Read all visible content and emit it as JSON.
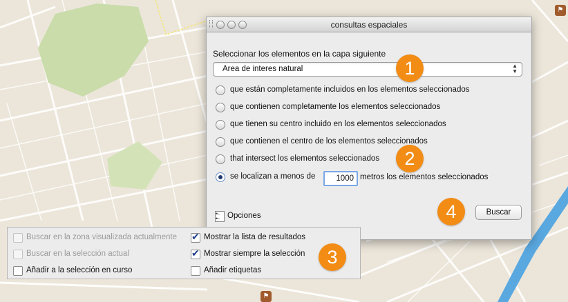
{
  "dialog": {
    "title": "consultas espaciales",
    "layer_caption": "Seleccionar los elementos en la capa siguiente",
    "layer_select": {
      "value": "Area de interes natural"
    },
    "radio_options": [
      {
        "label": "que están completamente incluidos en los elementos seleccionados",
        "selected": false
      },
      {
        "label": "que contienen completamente los elementos seleccionados",
        "selected": false
      },
      {
        "label": "que tienen su centro incluido en los elementos seleccionados",
        "selected": false
      },
      {
        "label": "que contienen el centro de los elementos seleccionados",
        "selected": false
      },
      {
        "label": "that intersect los elementos seleccionados",
        "selected": false
      },
      {
        "label": "se localizan a menos de",
        "selected": true
      }
    ],
    "distance_value": "1000",
    "distance_suffix": "metros  los elementos seleccionados",
    "options_label": "Opciones",
    "search_button": "Buscar"
  },
  "options_panel": {
    "items": [
      {
        "label": "Buscar en la zona visualizada actualmente",
        "checked": false,
        "enabled": false
      },
      {
        "label": "Mostrar la lista de resultados",
        "checked": true,
        "enabled": true
      },
      {
        "label": "Buscar en la selección actual",
        "checked": false,
        "enabled": false
      },
      {
        "label": "Mostrar siempre la selección",
        "checked": true,
        "enabled": true
      },
      {
        "label": "Añadir a la selección en curso",
        "checked": false,
        "enabled": true
      },
      {
        "label": "Añadir etiquetas",
        "checked": false,
        "enabled": true
      }
    ]
  },
  "badges": [
    "1",
    "2",
    "3",
    "4"
  ],
  "colors": {
    "badge": "#f28c14",
    "map_bg": "#ece6da",
    "park": "#c9dcaa",
    "river": "#5aa8e0"
  }
}
